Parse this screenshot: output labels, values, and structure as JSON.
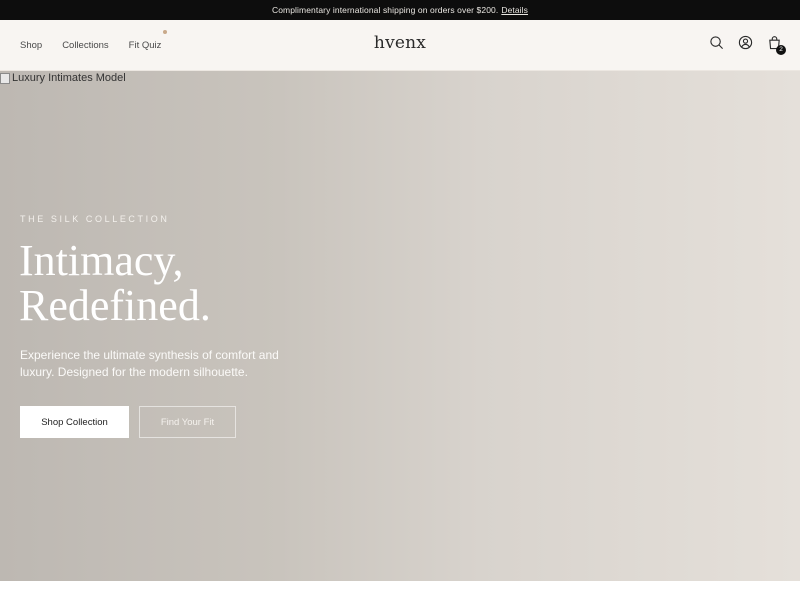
{
  "announcement": {
    "text": "Complimentary international shipping on orders over $200.",
    "link": "Details"
  },
  "header": {
    "nav": [
      {
        "label": "Shop"
      },
      {
        "label": "Collections"
      },
      {
        "label": "Fit Quiz"
      }
    ],
    "logo": "hvenx",
    "cart_count": "2",
    "icons": [
      "search-icon",
      "account-icon",
      "bag-icon"
    ]
  },
  "hero": {
    "image_alt": "Luxury Intimates Model",
    "eyebrow": "THE SILK COLLECTION",
    "headline_line1": "Intimacy,",
    "headline_line2": "Redefined.",
    "subtext": "Experience the ultimate synthesis of comfort and luxury. Designed for the modern silhouette.",
    "primary_cta": "Shop Collection",
    "secondary_cta": "Find Your Fit"
  },
  "colors": {
    "announcement_bg": "#0d0d0d",
    "header_bg": "#f8f5f2",
    "accent_dot": "#c9a98a",
    "hero_gradient_start": "#bdb8b2",
    "hero_gradient_end": "#e5e0da"
  }
}
